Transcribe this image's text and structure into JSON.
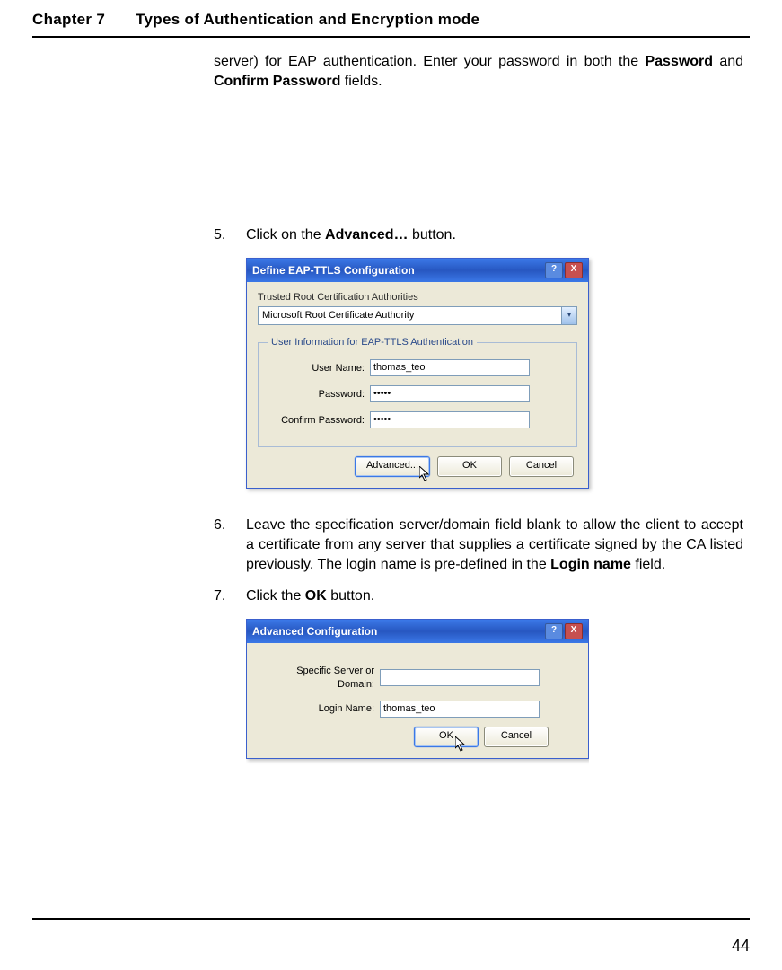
{
  "header": {
    "chapter_label": "Chapter 7",
    "chapter_title": "Types of Authentication and Encryption mode"
  },
  "intro_text_prefix": "server) for EAP authentication. Enter your password in both the ",
  "intro_bold_1": "Password",
  "intro_mid_1": " and ",
  "intro_bold_2": "Confirm Password",
  "intro_text_suffix": " fields.",
  "steps": {
    "s5": {
      "num": "5.",
      "p1": "Click on the ",
      "b1": "Advanced…",
      "p2": " button."
    },
    "s6": {
      "num": "6.",
      "p1": "Leave the specification server/domain field blank to allow the client to accept a certificate from any server that supplies a certificate signed by the CA listed previously. The login name is pre-defined in the ",
      "b1": "Login name",
      "p2": " field."
    },
    "s7": {
      "num": "7.",
      "p1": "Click the ",
      "b1": "OK",
      "p2": " button."
    }
  },
  "dialog1": {
    "title": "Define EAP-TTLS Configuration",
    "titlebar_help": "?",
    "titlebar_close": "X",
    "group_label": "Trusted Root Certification Authorities",
    "combo_value": "Microsoft Root Certificate Authority",
    "combo_arrow": "▾",
    "fieldset_legend": "User Information for EAP-TTLS Authentication",
    "labels": {
      "username": "User Name:",
      "password": "Password:",
      "confirm": "Confirm Password:"
    },
    "values": {
      "username": "thomas_teo",
      "password": "•••••",
      "confirm": "•••••"
    },
    "buttons": {
      "advanced": "Advanced...",
      "ok": "OK",
      "cancel": "Cancel"
    }
  },
  "dialog2": {
    "title": "Advanced Configuration",
    "titlebar_help": "?",
    "titlebar_close": "X",
    "labels": {
      "server": "Specific Server or Domain:",
      "login": "Login Name:"
    },
    "values": {
      "server": "",
      "login": "thomas_teo"
    },
    "buttons": {
      "ok": "OK",
      "cancel": "Cancel"
    }
  },
  "page_number": "44"
}
